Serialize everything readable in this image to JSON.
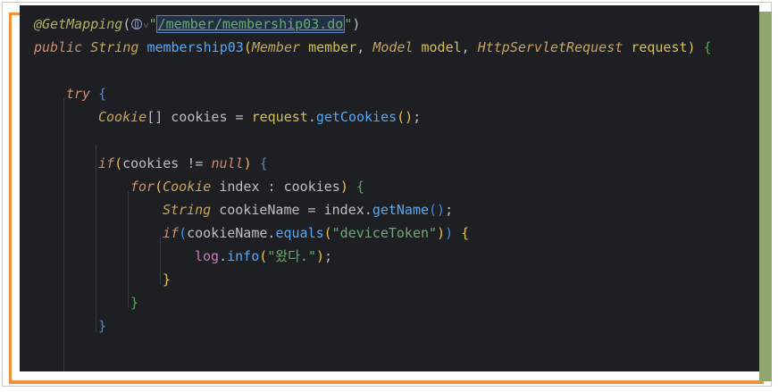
{
  "editor": {
    "lines": {
      "l1": {
        "annotation": "@GetMapping",
        "open_paren": "(",
        "chevron": "˅",
        "quote_open": "\"",
        "url": "/member/membership03.do",
        "quote_close": "\"",
        "close_paren": ")"
      },
      "l2": {
        "kw_public": "public",
        "type_string": "String",
        "method": "membership03",
        "paren_open": "(",
        "type_member": "Member",
        "param_member": "member",
        "comma1": ", ",
        "type_model": "Model",
        "param_model": "model",
        "comma2": ", ",
        "type_req": "HttpServletRequest",
        "param_req": "request",
        "paren_close": ")",
        "brace": "{"
      },
      "l3": {
        "kw_try": "try",
        "brace": "{"
      },
      "l4": {
        "type_cookie": "Cookie",
        "brackets": "[]",
        "var": "cookies",
        "eq": " = ",
        "obj": "request",
        "dot": ".",
        "method": "getCookies",
        "parens": "()",
        "semi": ";"
      },
      "l5": {
        "kw_if": "if",
        "paren_open": "(",
        "cond": "cookies != ",
        "kw_null": "null",
        "paren_close": ")",
        "brace": "{"
      },
      "l6": {
        "kw_for": "for",
        "paren_open": "(",
        "type_cookie": "Cookie",
        "var": "index",
        "colon": " : ",
        "iter": "cookies",
        "paren_close": ")",
        "brace": "{"
      },
      "l7": {
        "type_string": "String",
        "var": "cookieName",
        "eq": " = ",
        "obj": "index",
        "dot": ".",
        "method": "getName",
        "parens": "()",
        "semi": ";"
      },
      "l8": {
        "kw_if": "if",
        "paren_open": "(",
        "obj": "cookieName",
        "dot": ".",
        "method": "equals",
        "inner_open": "(",
        "str": "\"deviceToken\"",
        "inner_close": ")",
        "paren_close": ")",
        "brace": "{"
      },
      "l9": {
        "obj": "log",
        "dot": ".",
        "method": "info",
        "paren_open": "(",
        "str": "\"왔다.\"",
        "paren_close": ")",
        "semi": ";"
      },
      "l10": {
        "brace": "}"
      },
      "l11": {
        "brace": "}"
      },
      "l12": {
        "brace": "}"
      }
    },
    "colors": {
      "background": "#1e1f22",
      "keyword": "#cf8e6d",
      "type": "#c8a35c",
      "method": "#56a8f5",
      "string": "#6aab73",
      "field": "#c77dbb",
      "annotation": "#b3ae60"
    }
  }
}
